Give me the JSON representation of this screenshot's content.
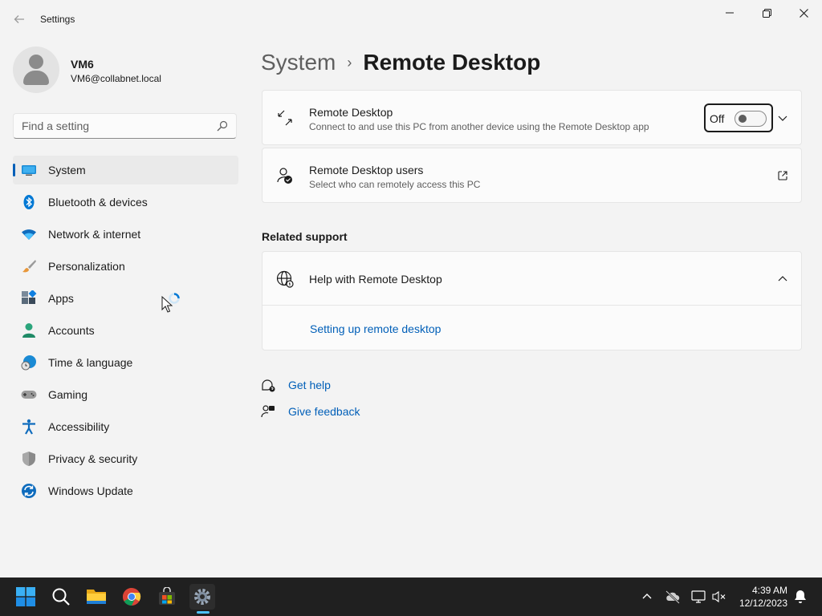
{
  "window": {
    "app_title": "Settings",
    "back_icon": "back-arrow-icon",
    "minimize_icon": "minimize-icon",
    "maximize_icon": "restore-icon",
    "close_icon": "close-icon"
  },
  "profile": {
    "name": "VM6",
    "email": "VM6@collabnet.local"
  },
  "search": {
    "placeholder": "Find a setting",
    "value": ""
  },
  "sidebar": {
    "items": [
      {
        "label": "System",
        "icon": "system-monitor-icon",
        "selected": true
      },
      {
        "label": "Bluetooth & devices",
        "icon": "bluetooth-icon"
      },
      {
        "label": "Network & internet",
        "icon": "wifi-icon"
      },
      {
        "label": "Personalization",
        "icon": "paintbrush-icon"
      },
      {
        "label": "Apps",
        "icon": "apps-icon"
      },
      {
        "label": "Accounts",
        "icon": "accounts-icon"
      },
      {
        "label": "Time & language",
        "icon": "globe-clock-icon"
      },
      {
        "label": "Gaming",
        "icon": "gamepad-icon"
      },
      {
        "label": "Accessibility",
        "icon": "accessibility-icon"
      },
      {
        "label": "Privacy & security",
        "icon": "shield-icon"
      },
      {
        "label": "Windows Update",
        "icon": "update-icon"
      }
    ]
  },
  "breadcrumb": {
    "parent": "System",
    "separator": "›",
    "current": "Remote Desktop"
  },
  "remote_desktop": {
    "title": "Remote Desktop",
    "description": "Connect to and use this PC from another device using the Remote Desktop app",
    "toggle_label": "Off",
    "toggle_on": false
  },
  "remote_users": {
    "title": "Remote Desktop users",
    "description": "Select who can remotely access this PC"
  },
  "related_support": {
    "heading": "Related support",
    "help_title": "Help with Remote Desktop",
    "links": [
      "Setting up remote desktop"
    ]
  },
  "footer_links": {
    "get_help": "Get help",
    "give_feedback": "Give feedback"
  },
  "taskbar": {
    "apps": [
      "start-icon",
      "search-icon",
      "file-explorer-icon",
      "chrome-icon",
      "store-icon",
      "settings-icon"
    ],
    "time": "4:39 AM",
    "date": "12/12/2023"
  },
  "colors": {
    "accent": "#005fb8",
    "taskbar": "#202020",
    "background": "#f3f3f3"
  }
}
